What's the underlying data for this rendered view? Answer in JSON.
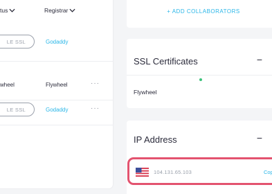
{
  "table": {
    "headers": {
      "status": "tus",
      "registrar": "Registrar"
    },
    "rows": [
      {
        "ssl_badge": "LE SSL",
        "registrar": "Godaddy",
        "registrar_is_link": true,
        "has_menu": false,
        "host": ""
      },
      {
        "ssl_badge": "",
        "host": "wheel",
        "registrar": "Flywheel",
        "registrar_is_link": false,
        "has_menu": true
      },
      {
        "ssl_badge": "LE SSL",
        "registrar": "Godaddy",
        "registrar_is_link": true,
        "has_menu": true,
        "host": ""
      }
    ],
    "menu_label": "···"
  },
  "collaborators": {
    "add_label": "+ ADD COLLABORATORS"
  },
  "ssl_section": {
    "title": "SSL Certificates",
    "collapse_symbol": "−",
    "host": "Flywheel",
    "status_color": "#3cc27a"
  },
  "ip_section": {
    "title": "IP Address",
    "collapse_symbol": "−",
    "flag_icon": "us-flag-icon",
    "ip": "104.131.65.103",
    "copy_label": "Copy",
    "highlight_color": "#e3536f"
  },
  "colors": {
    "link": "#29b6e8",
    "text": "#2b2b3b",
    "muted": "#9aa0ab"
  }
}
